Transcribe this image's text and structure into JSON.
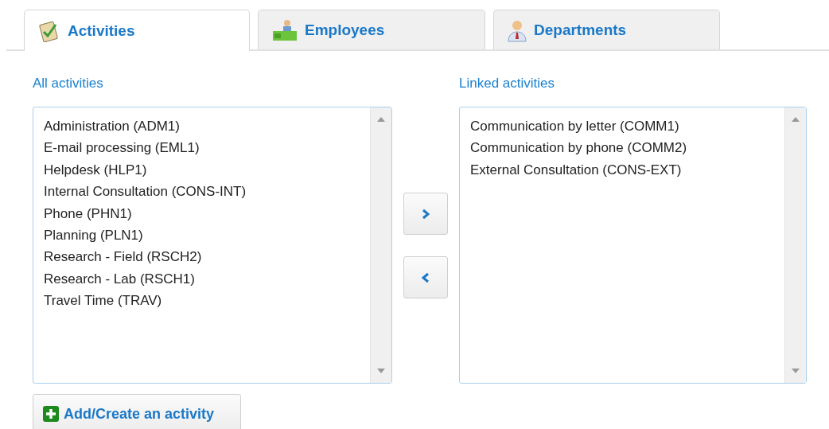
{
  "tabs": [
    {
      "label": "Activities",
      "kind": "clipboard",
      "selected": true
    },
    {
      "label": "Employees",
      "kind": "desk",
      "selected": false
    },
    {
      "label": "Departments",
      "kind": "person",
      "selected": false
    }
  ],
  "all_activities": {
    "label": "All activities",
    "items": [
      "Administration (ADM1)",
      "E-mail processing (EML1)",
      "Helpdesk (HLP1)",
      "Internal Consultation (CONS-INT)",
      "Phone (PHN1)",
      "Planning (PLN1)",
      "Research - Field (RSCH2)",
      "Research - Lab (RSCH1)",
      "Travel Time (TRAV)"
    ]
  },
  "linked_activities": {
    "label": "Linked activities",
    "items": [
      "Communication by letter (COMM1)",
      "Communication by phone (COMM2)",
      "External Consultation (CONS-EXT)"
    ]
  },
  "move_buttons": [
    {
      "kind": "right"
    },
    {
      "kind": "left"
    }
  ],
  "add_button": {
    "label": "Add/Create an activity"
  }
}
